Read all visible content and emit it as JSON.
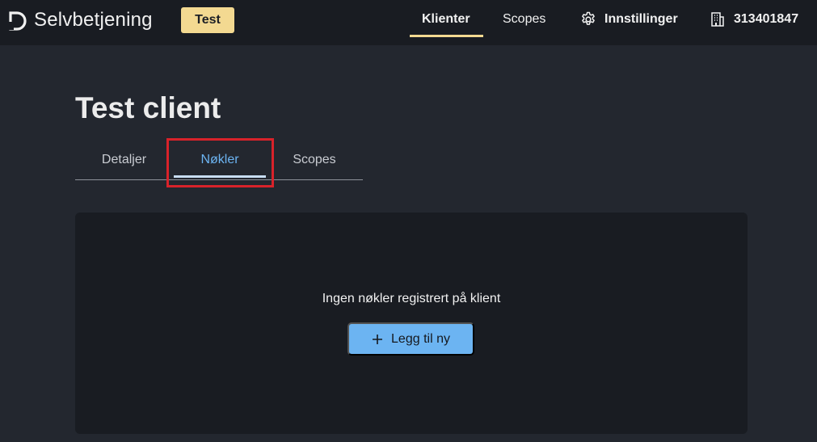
{
  "header": {
    "brand": "Selvbetjening",
    "environment_badge": "Test",
    "nav": {
      "clients": "Klienter",
      "scopes": "Scopes",
      "settings": "Innstillinger",
      "organization": "313401847"
    },
    "active_nav": "clients",
    "icons": {
      "logo": "logo-icon",
      "settings": "gear-icon",
      "organization": "building-icon"
    }
  },
  "page": {
    "title": "Test client",
    "tabs": [
      {
        "label": "Detaljer",
        "active": false
      },
      {
        "label": "Nøkler",
        "active": true
      },
      {
        "label": "Scopes",
        "active": false
      }
    ]
  },
  "keys_panel": {
    "empty_message": "Ingen nøkler registrert på klient",
    "add_button_label": "Legg til ny",
    "add_button_icon": "plus-icon"
  },
  "colors": {
    "accent_yellow": "#f3d991",
    "accent_blue": "#6cb4f2",
    "highlight_red": "#d8222a",
    "background": "#23272f",
    "surface": "#191c22"
  }
}
